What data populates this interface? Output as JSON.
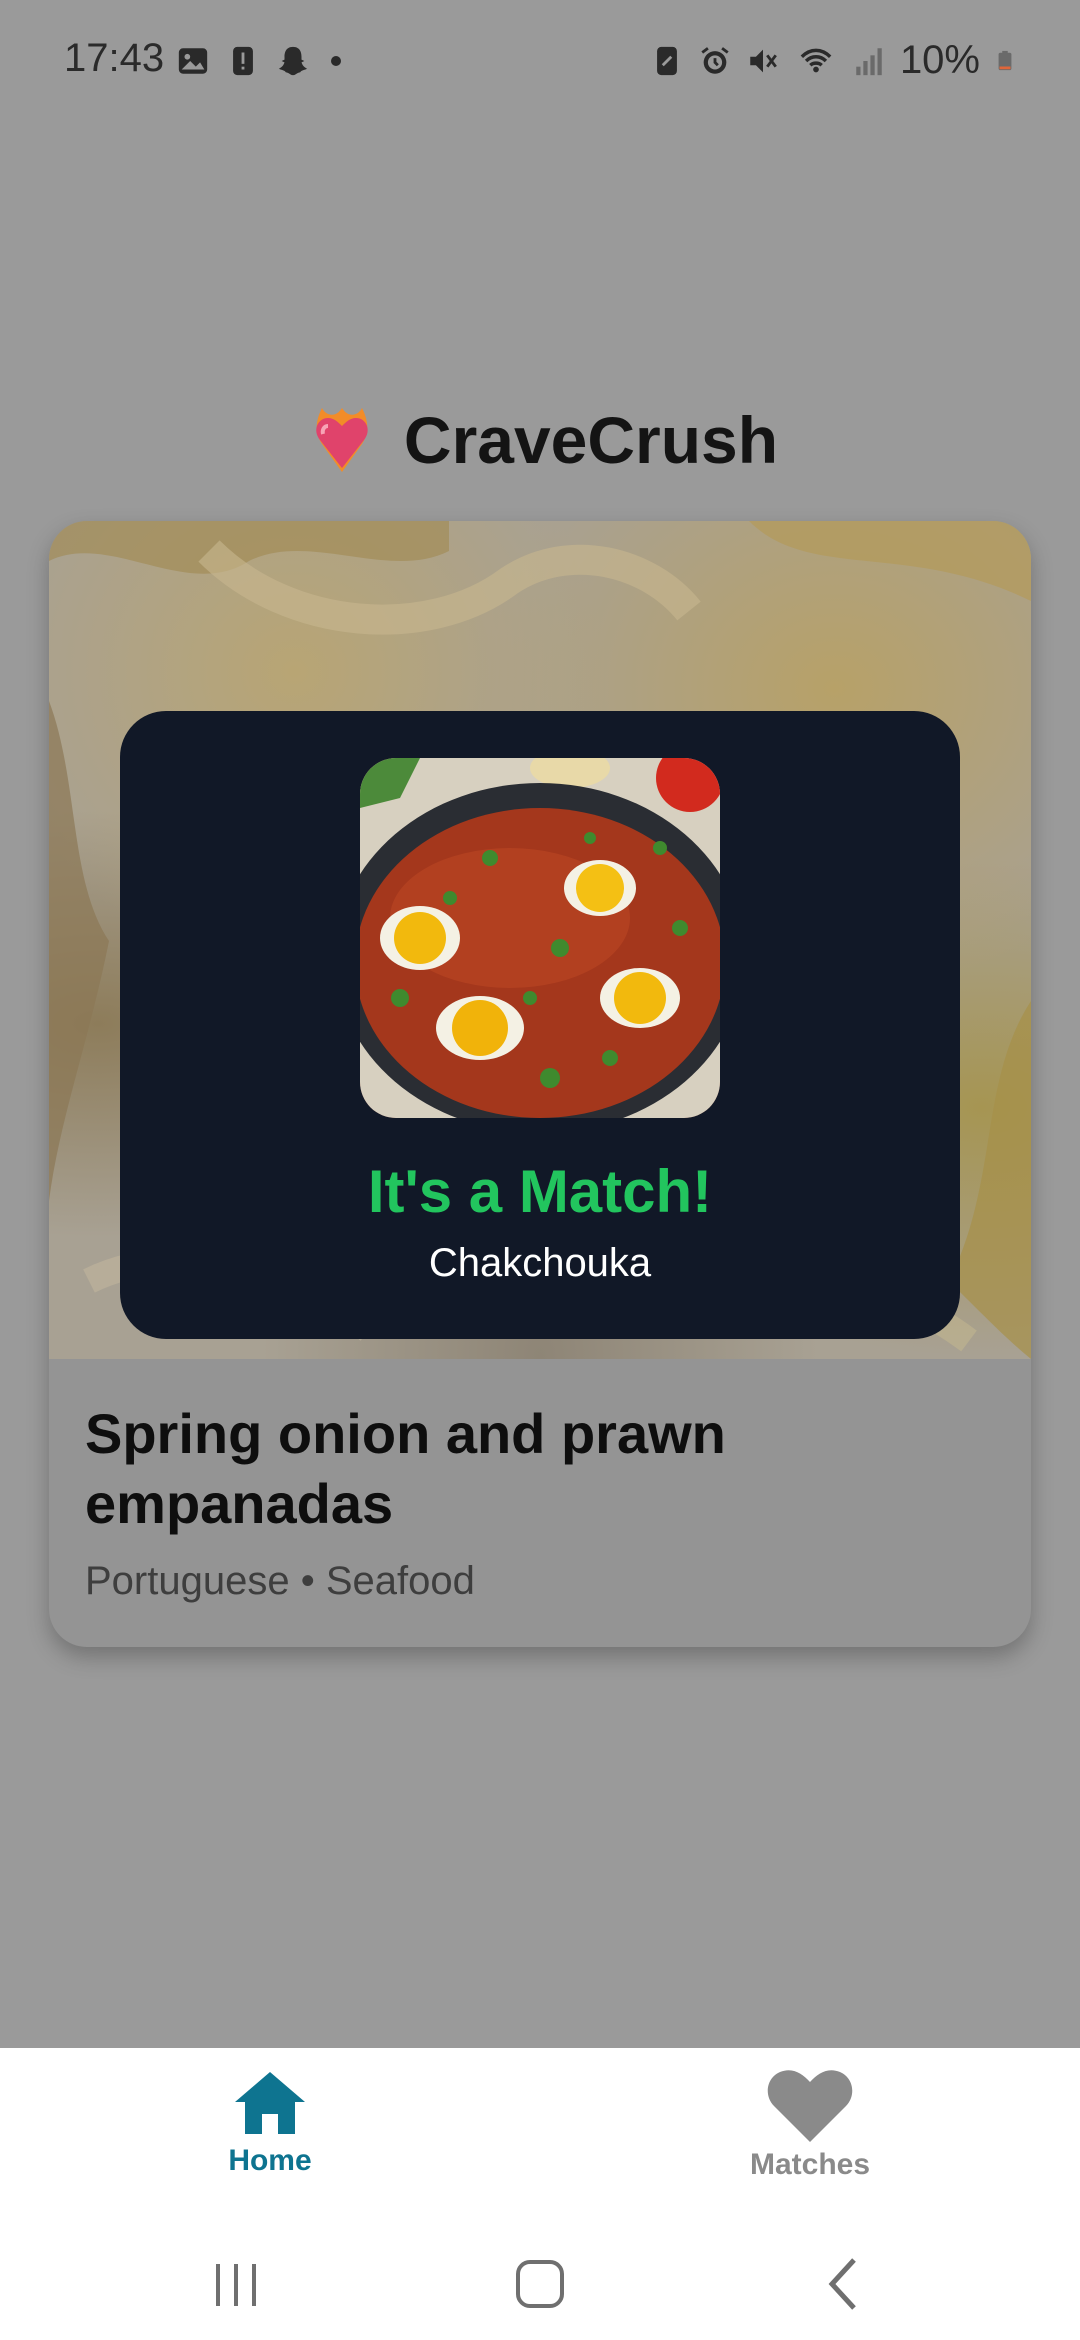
{
  "status_bar": {
    "time": "17:43",
    "battery": "10%",
    "left_icons": [
      "gallery-icon",
      "alert-icon",
      "snapchat-icon",
      "dot-icon"
    ],
    "right_icons": [
      "nfc-icon",
      "alarm-icon",
      "mute-icon",
      "wifi-icon",
      "signal-icon",
      "battery-icon"
    ]
  },
  "header": {
    "title": "CraveCrush",
    "logo_icon": "heart-on-fire-icon"
  },
  "card": {
    "title": "Spring onion and prawn empanadas",
    "meta": "Portuguese • Seafood"
  },
  "match": {
    "heading": "It's a Match!",
    "dish": "Chakchouka",
    "heading_color": "#22c55e",
    "background_color": "#111827"
  },
  "bottom_nav": {
    "items": [
      {
        "label": "Home",
        "icon": "home-icon",
        "active": true,
        "color": "#0e7490"
      },
      {
        "label": "Matches",
        "icon": "heart-icon",
        "active": false,
        "color": "#8a8a8a"
      }
    ]
  },
  "system_nav": {
    "buttons": [
      "recents-icon",
      "home-circle-icon",
      "back-icon"
    ]
  }
}
